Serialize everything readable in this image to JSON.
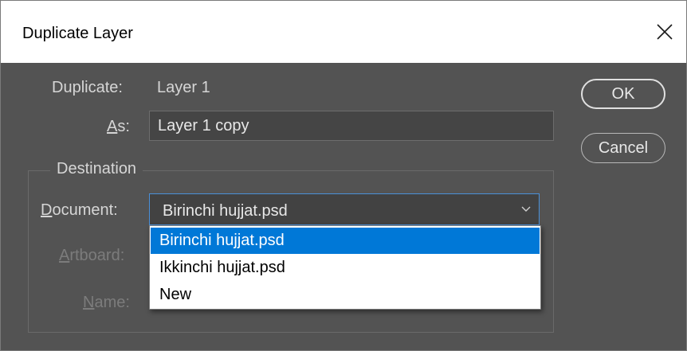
{
  "window": {
    "title": "Duplicate Layer"
  },
  "duplicate": {
    "label": "Duplicate:",
    "value": "Layer 1"
  },
  "as": {
    "label_underline": "A",
    "label_rest": "s:",
    "value": "Layer 1 copy"
  },
  "buttons": {
    "ok": "OK",
    "cancel": "Cancel"
  },
  "destination": {
    "title": "Destination",
    "document_label_underline": "D",
    "document_label_rest": "ocument:",
    "document_selected": "Birinchi hujjat.psd",
    "document_options": [
      "Birinchi hujjat.psd",
      "Ikkinchi hujjat.psd",
      "New"
    ],
    "artboard_label_underline": "A",
    "artboard_label_rest": "rtboard:",
    "name_label_underline": "N",
    "name_label_rest": "ame:"
  },
  "icons": {
    "close": "close-icon",
    "chevron": "chevron-down-icon"
  },
  "colors": {
    "dialog_bg": "#535353",
    "accent": "#0078d7",
    "titlebar": "#ffffff"
  }
}
